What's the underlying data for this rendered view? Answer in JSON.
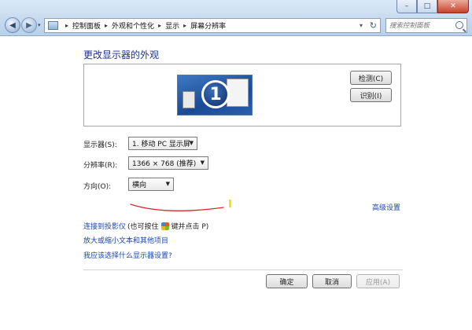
{
  "window": {
    "minimize_label": "–",
    "maximize_label": "□",
    "close_label": "✕"
  },
  "nav": {
    "back_glyph": "◀",
    "forward_glyph": "▶",
    "dropdown_glyph": "▾"
  },
  "address_bar": {
    "crumbs": [
      "控制面板",
      "外观和个性化",
      "显示",
      "屏幕分辨率"
    ],
    "separator": "▸",
    "dropdown_glyph": "▾",
    "refresh_glyph": "↻"
  },
  "search": {
    "placeholder": "搜索控制面板"
  },
  "page": {
    "title": "更改显示器的外观"
  },
  "preview": {
    "monitor_number": "1",
    "detect_label": "检测(C)",
    "identify_label": "识别(I)"
  },
  "settings": {
    "display_label": "显示器(S):",
    "display_value": "1. 移动 PC 显示屏",
    "resolution_label": "分辨率(R):",
    "resolution_value": "1366 × 768 (推荐)",
    "orientation_label": "方向(O):",
    "orientation_value": "横向",
    "select_arrow": "▼"
  },
  "links": {
    "advanced": "高级设置",
    "projector": "连接到投影仪",
    "projector_hint_pre": "(也可按住",
    "projector_hint_post": "键并点击 P)",
    "text_size": "放大或缩小文本和其他项目",
    "which_settings": "我应该选择什么显示器设置?"
  },
  "footer": {
    "ok_label": "确定",
    "cancel_label": "取消",
    "apply_label": "应用(A)"
  },
  "colors": {
    "title_blue": "#1e3287",
    "link_blue": "#1c47a8",
    "annotation_red": "#d22a2a",
    "annotation_yellow": "#f3e900"
  },
  "icons": {
    "control_panel": "control-panel-icon",
    "windows_key": "windows-logo-icon",
    "search": "search-icon"
  }
}
